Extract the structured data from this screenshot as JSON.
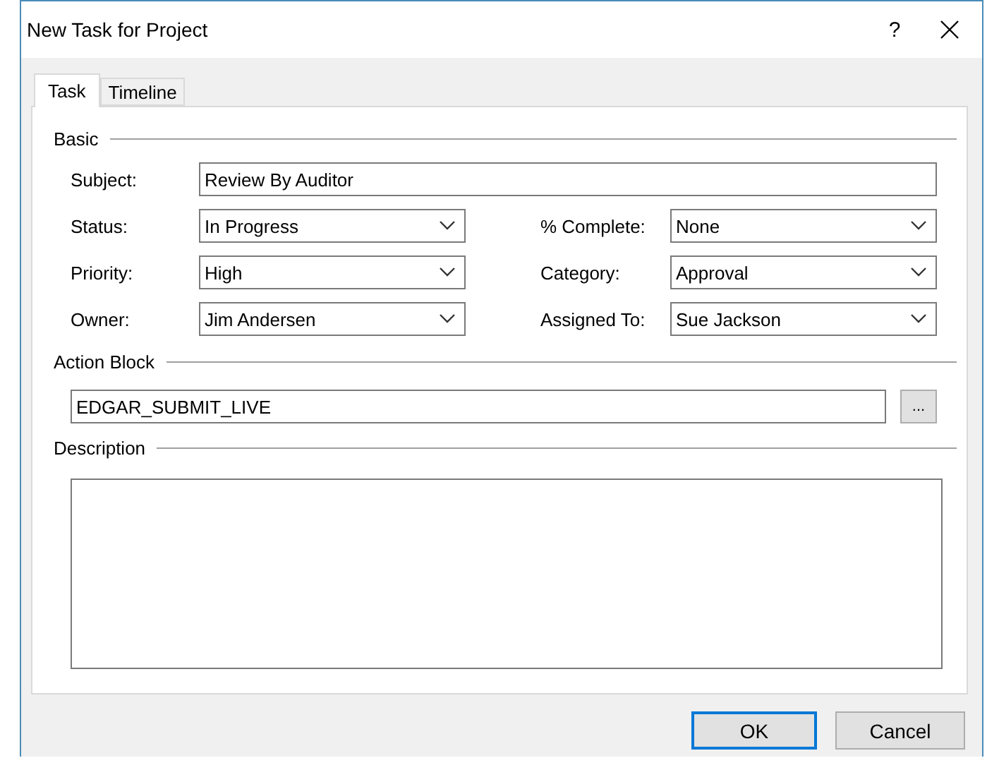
{
  "window": {
    "title": "New Task for Project",
    "help": "?"
  },
  "tabs": [
    {
      "label": "Task",
      "selected": true
    },
    {
      "label": "Timeline",
      "selected": false
    }
  ],
  "basic": {
    "title": "Basic",
    "subject": {
      "label": "Subject:",
      "value": "Review By Auditor"
    },
    "rows": [
      [
        {
          "label": "Status:",
          "value": "In Progress"
        },
        {
          "label": "% Complete:",
          "value": "None"
        }
      ],
      [
        {
          "label": "Priority:",
          "value": "High"
        },
        {
          "label": "Category:",
          "value": "Approval"
        }
      ],
      [
        {
          "label": "Owner:",
          "value": "Jim Andersen"
        },
        {
          "label": "Assigned To:",
          "value": "Sue Jackson"
        }
      ]
    ]
  },
  "action_block": {
    "title": "Action Block",
    "value": "EDGAR_SUBMIT_LIVE",
    "browse": "..."
  },
  "description": {
    "title": "Description"
  },
  "buttons": [
    {
      "label": "OK",
      "default": true
    },
    {
      "label": "Cancel",
      "default": false
    }
  ]
}
